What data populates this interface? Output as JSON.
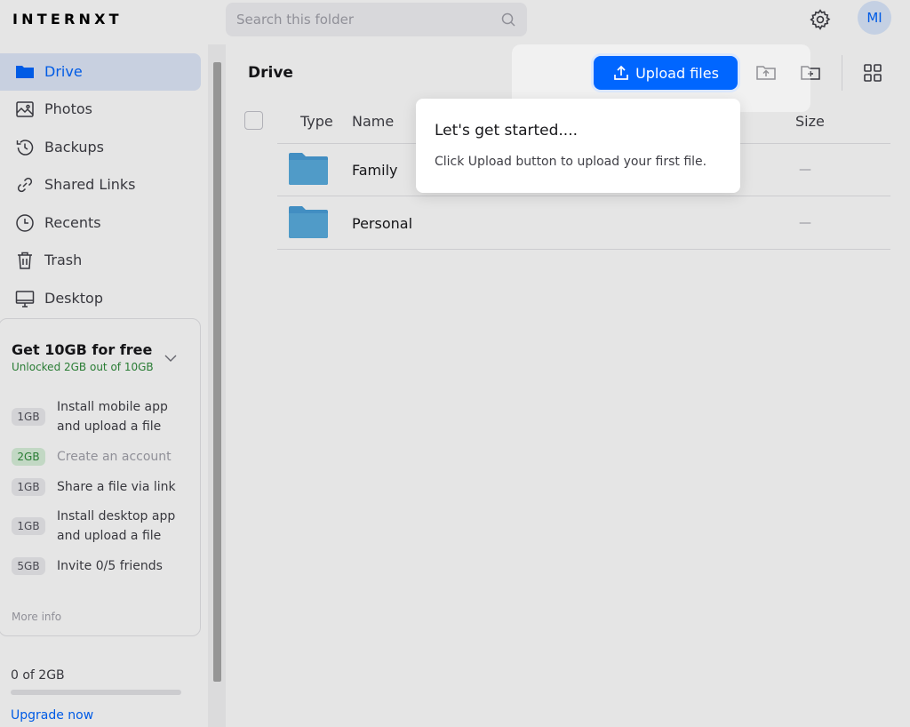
{
  "header": {
    "logo": "INTERNXT",
    "search_placeholder": "Search this folder",
    "avatar_initials": "MI"
  },
  "sidebar": {
    "items": [
      {
        "label": "Drive",
        "icon": "folder-icon",
        "active": true
      },
      {
        "label": "Photos",
        "icon": "image-icon"
      },
      {
        "label": "Backups",
        "icon": "history-icon"
      },
      {
        "label": "Shared Links",
        "icon": "link-icon"
      },
      {
        "label": "Recents",
        "icon": "clock-icon"
      },
      {
        "label": "Trash",
        "icon": "trash-icon"
      },
      {
        "label": "Desktop",
        "icon": "monitor-icon"
      }
    ],
    "promo": {
      "title": "Get 10GB for free",
      "subtitle": "Unlocked 2GB out of 10GB",
      "tasks": [
        {
          "size": "1GB",
          "text_line1": "Install mobile app",
          "text_line2": "and upload a file",
          "done": false
        },
        {
          "size": "2GB",
          "text_line1": "Create an account",
          "text_line2": "",
          "done": true
        },
        {
          "size": "1GB",
          "text_line1": "Share a file via link",
          "text_line2": "",
          "done": false
        },
        {
          "size": "1GB",
          "text_line1": "Install desktop app",
          "text_line2": "and upload a file",
          "done": false
        },
        {
          "size": "5GB",
          "text_line1": "Invite 0/5 friends",
          "text_line2": "",
          "done": false
        }
      ],
      "more_info": "More info"
    },
    "usage_text": "0 of 2GB",
    "usage_fraction": 0,
    "upgrade_label": "Upgrade now"
  },
  "main": {
    "title": "Drive",
    "upload_label": "Upload files",
    "columns": {
      "type": "Type",
      "name": "Name",
      "size": "Size"
    },
    "rows": [
      {
        "name": "Family",
        "size": "—"
      },
      {
        "name": "Personal",
        "size": "—"
      }
    ]
  },
  "tooltip": {
    "title": "Let's get started....",
    "body": "Click Upload button to upload your first file."
  },
  "colors": {
    "accent": "#0066ff",
    "active_bg": "#dfe8fa",
    "folder": "#5aaddf",
    "success": "#2e8b3a"
  }
}
